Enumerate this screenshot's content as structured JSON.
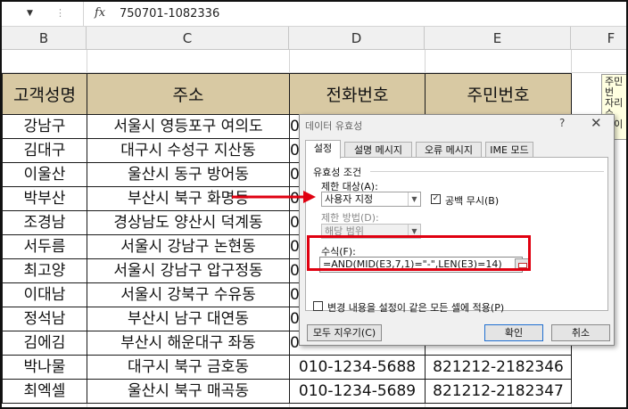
{
  "formula_bar": {
    "name_box": "",
    "fx_label": "fx",
    "value": "750701-1082336"
  },
  "columns": [
    "B",
    "C",
    "D",
    "E",
    "F"
  ],
  "table": {
    "headers": [
      "고객성명",
      "주소",
      "전화번호",
      "주민번호"
    ],
    "rows": [
      {
        "name": "강남구",
        "address": "서울시 영등포구 여의도",
        "phone": "0",
        "id": ""
      },
      {
        "name": "김대구",
        "address": "대구시 수성구 지산동",
        "phone": "0",
        "id": ""
      },
      {
        "name": "이울산",
        "address": "울산시 동구 방어동",
        "phone": "0",
        "id": ""
      },
      {
        "name": "박부산",
        "address": "부산시 북구 화명동",
        "phone": "0",
        "id": ""
      },
      {
        "name": "조경남",
        "address": "경상남도 양산시 덕계동",
        "phone": "0",
        "id": ""
      },
      {
        "name": "서두름",
        "address": "서울시 강남구 논현동",
        "phone": "0",
        "id": ""
      },
      {
        "name": "최고양",
        "address": "서울시 강남구 압구정동",
        "phone": "0",
        "id": ""
      },
      {
        "name": "이대남",
        "address": "서울시 강북구 수유동",
        "phone": "0",
        "id": ""
      },
      {
        "name": "정석남",
        "address": "부산시 남구 대연동",
        "phone": "0",
        "id": ""
      },
      {
        "name": "김에김",
        "address": "부산시 해운대구 좌동",
        "phone": "0",
        "id": ""
      },
      {
        "name": "박나물",
        "address": "대구시 북구 금호동",
        "phone": "010-1234-5688",
        "id": "821212-2182346"
      },
      {
        "name": "최엑셀",
        "address": "울산시 북구 매곡동",
        "phone": "010-1234-5689",
        "id": "821212-2182347"
      }
    ]
  },
  "comment_lines": [
    "주민번",
    "자리수",
    "하이픈",
    "합계",
    "력"
  ],
  "dialog": {
    "title": "데이터 유효성",
    "help": "?",
    "close": "✕",
    "tabs": [
      "설정",
      "설명 메시지",
      "오류 메시지",
      "IME 모드"
    ],
    "group_label": "유효성 조건",
    "allow_label": "제한 대상(A):",
    "allow_value": "사용자 지정",
    "ignore_blank_label": "공백 무시(B)",
    "ignore_blank_checked": true,
    "data_label": "제한 방법(D):",
    "data_value": "해당 범위",
    "formula_label": "수식(F):",
    "formula_value": "=AND(MID(E3,7,1)=\"-\",LEN(E3)=14)",
    "apply_all_label": "변경 내용을 설정이 같은 모든 셀에 적용(P)",
    "apply_all_checked": false,
    "clear_all_label": "모두 지우기(C)",
    "ok_label": "확인",
    "cancel_label": "취소"
  },
  "annotation_color": "#e00010",
  "header_fill": "#d8c9a3"
}
